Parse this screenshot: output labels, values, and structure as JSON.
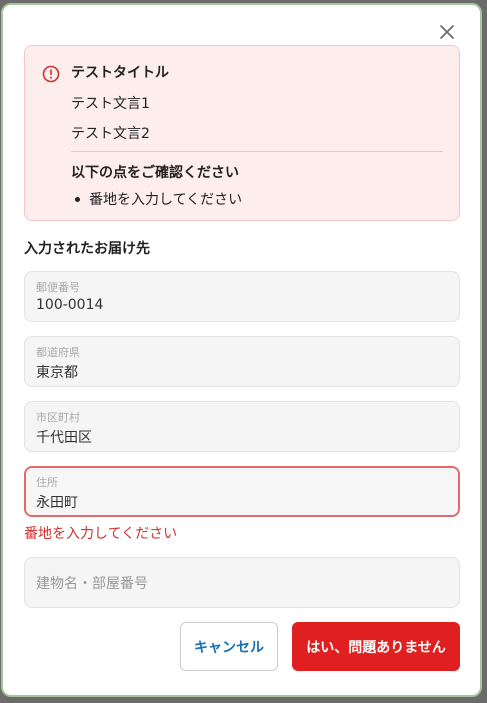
{
  "alert": {
    "title": "テストタイトル",
    "lines": [
      "テスト文言1",
      "テスト文言2"
    ],
    "subheading": "以下の点をご確認ください",
    "items": [
      "番地を入力してください"
    ],
    "icon": "alert-circle-icon",
    "color": "#d32f2f"
  },
  "section": {
    "heading": "入力されたお届け先"
  },
  "fields": {
    "postal": {
      "label": "郵便番号",
      "value": "100-0014"
    },
    "prefecture": {
      "label": "都道府県",
      "value": "東京都"
    },
    "city": {
      "label": "市区町村",
      "value": "千代田区"
    },
    "address": {
      "label": "住所",
      "value": "永田町",
      "error": "番地を入力してください"
    },
    "building": {
      "placeholder": "建物名・部屋番号"
    }
  },
  "buttons": {
    "cancel": "キャンセル",
    "confirm": "はい、問題ありません"
  },
  "colors": {
    "primary": "#e02020",
    "link": "#1a6fb0",
    "error": "#d32f2f"
  }
}
